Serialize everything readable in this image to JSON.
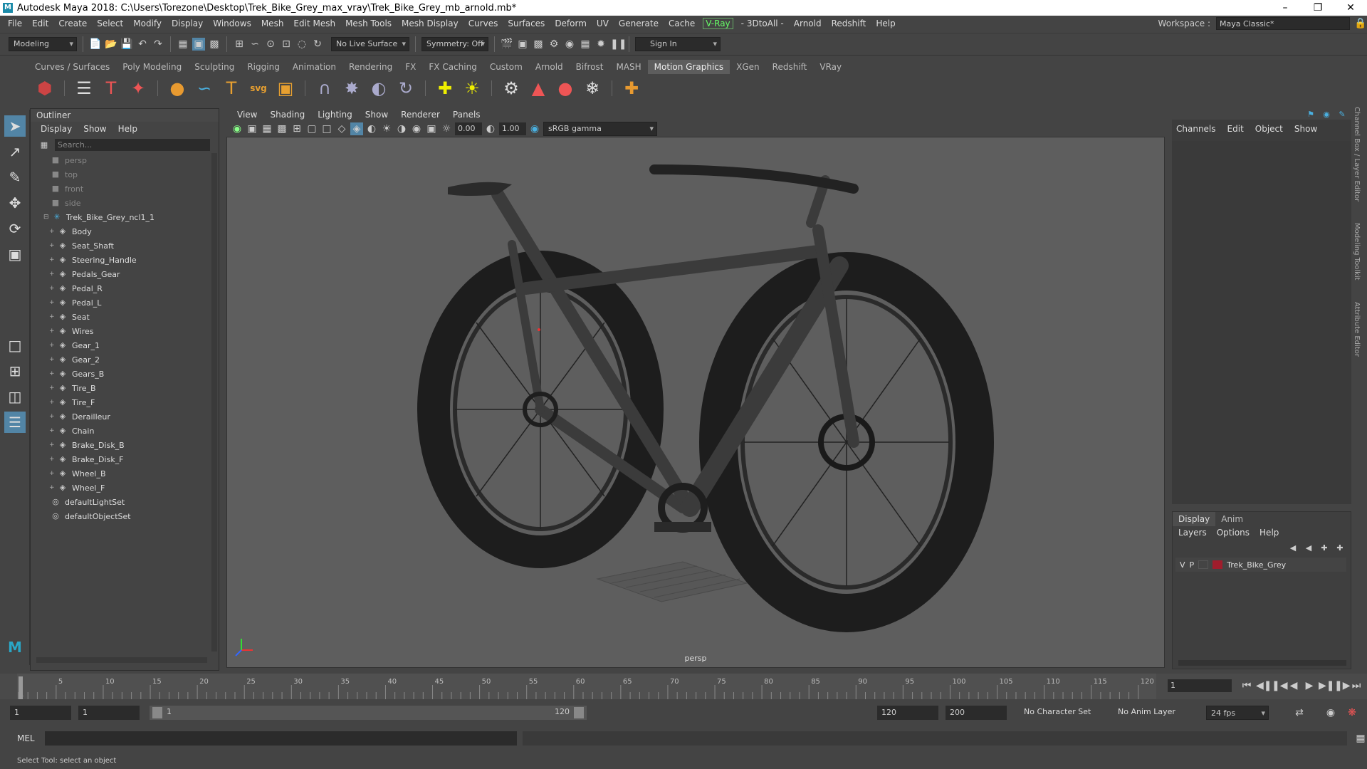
{
  "window": {
    "title": "Autodesk Maya 2018: C:\\Users\\Torezone\\Desktop\\Trek_Bike_Grey_max_vray\\Trek_Bike_Grey_mb_arnold.mb*",
    "logo": "M"
  },
  "menubar": {
    "items": [
      "File",
      "Edit",
      "Create",
      "Select",
      "Modify",
      "Display",
      "Windows",
      "Mesh",
      "Edit Mesh",
      "Mesh Tools",
      "Mesh Display",
      "Curves",
      "Surfaces",
      "Deform",
      "UV",
      "Generate",
      "Cache"
    ],
    "vray": "V-Ray",
    "items2": [
      "- 3DtoAll -",
      "Arnold",
      "Redshift",
      "Help"
    ],
    "workspace_label": "Workspace :",
    "workspace_value": "Maya Classic*"
  },
  "statusline": {
    "mode": "Modeling",
    "live_surface": "No Live Surface",
    "symmetry": "Symmetry: Off",
    "sign_in": "Sign In"
  },
  "shelf": {
    "tabs": [
      "Curves / Surfaces",
      "Poly Modeling",
      "Sculpting",
      "Rigging",
      "Animation",
      "Rendering",
      "FX",
      "FX Caching",
      "Custom",
      "Arnold",
      "Bifrost",
      "MASH",
      "Motion Graphics",
      "XGen",
      "Redshift",
      "VRay"
    ],
    "active_tab": "Motion Graphics",
    "svg_label": "svg"
  },
  "outliner": {
    "title": "Outliner",
    "menu": [
      "Display",
      "Show",
      "Help"
    ],
    "search_placeholder": "Search...",
    "cameras": [
      "persp",
      "top",
      "front",
      "side"
    ],
    "group": "Trek_Bike_Grey_ncl1_1",
    "meshes": [
      "Body",
      "Seat_Shaft",
      "Steering_Handle",
      "Pedals_Gear",
      "Pedal_R",
      "Pedal_L",
      "Seat",
      "Wires",
      "Gear_1",
      "Gear_2",
      "Gears_B",
      "Tire_B",
      "Tire_F",
      "Derailleur",
      "Chain",
      "Brake_Disk_B",
      "Brake_Disk_F",
      "Wheel_B",
      "Wheel_F"
    ],
    "sets": [
      "defaultLightSet",
      "defaultObjectSet"
    ]
  },
  "viewport": {
    "menu": [
      "View",
      "Shading",
      "Lighting",
      "Show",
      "Renderer",
      "Panels"
    ],
    "exposure": "0.00",
    "gamma": "1.00",
    "color_space": "sRGB gamma",
    "camera_label": "persp"
  },
  "channelbox": {
    "menu": [
      "Channels",
      "Edit",
      "Object",
      "Show"
    ]
  },
  "layers": {
    "tabs": [
      "Display",
      "Anim"
    ],
    "menu": [
      "Layers",
      "Options",
      "Help"
    ],
    "row": {
      "v": "V",
      "p": "P",
      "name": "Trek_Bike_Grey",
      "color": "#a01d2c"
    }
  },
  "sidetabs": [
    "Channel Box / Layer Editor",
    "Modeling Toolkit",
    "Attribute Editor"
  ],
  "timeline": {
    "ticks": [
      5,
      10,
      15,
      20,
      25,
      30,
      35,
      40,
      45,
      50,
      55,
      60,
      65,
      70,
      75,
      80,
      85,
      90,
      95,
      100,
      105,
      110,
      115,
      120
    ],
    "first_tick": "1",
    "current_frame": "1"
  },
  "range": {
    "start": "1",
    "playback_start": "1",
    "slider_start": "1",
    "slider_end": "120",
    "playback_end": "120",
    "end": "200",
    "character_set": "No Character Set",
    "anim_layer": "No Anim Layer",
    "fps": "24 fps"
  },
  "cmdline": {
    "label": "MEL"
  },
  "helpline": {
    "text": "Select Tool: select an object"
  }
}
